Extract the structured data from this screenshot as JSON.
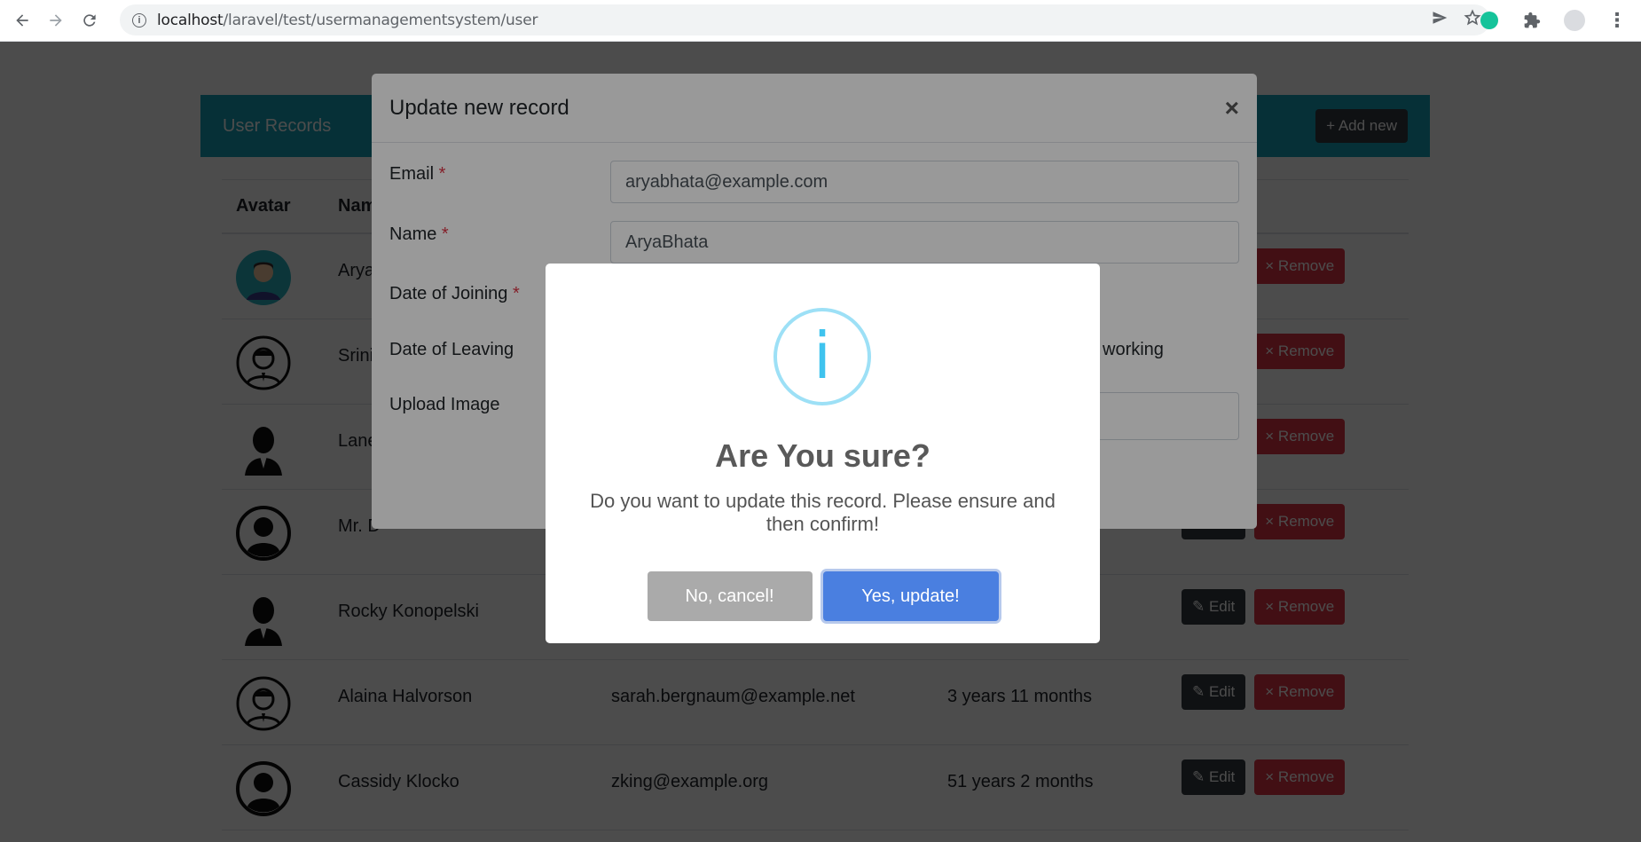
{
  "browser": {
    "url_host": "localhost",
    "url_path": "/laravel/test/usermanagementsystem/user"
  },
  "card": {
    "title": "User Records",
    "add_new_label": "+ Add new"
  },
  "table": {
    "headers": [
      "Avatar",
      "Name"
    ],
    "rows": [
      {
        "name": "Arya",
        "email": "",
        "duration": "",
        "avatar": "avatar-colored-icon"
      },
      {
        "name": "Srini",
        "email": "",
        "duration": "",
        "avatar": "man-outline-icon"
      },
      {
        "name": "Lane",
        "email": "",
        "duration": "",
        "avatar": "woman-silhouette-icon"
      },
      {
        "name": "Mr. D",
        "email": "",
        "duration": "",
        "avatar": "person-circle-icon"
      },
      {
        "name": "Rocky Konopelski",
        "email": "",
        "duration": "",
        "avatar": "woman-silhouette-icon"
      },
      {
        "name": "Alaina Halvorson",
        "email": "sarah.bergnaum@example.net",
        "duration": "3 years 11 months",
        "avatar": "man-outline-icon"
      },
      {
        "name": "Cassidy Klocko",
        "email": "zking@example.org",
        "duration": "51 years 2 months",
        "avatar": "person-circle-icon"
      }
    ],
    "edit_label": "✎ Edit",
    "remove_label": "× Remove"
  },
  "modal": {
    "title": "Update new record",
    "close": "×",
    "email_label": "Email",
    "email_value": "aryabhata@example.com",
    "name_label": "Name",
    "name_value": "AryaBhata",
    "doj_label": "Date of Joining",
    "dol_label": "Date of Leaving",
    "still_working": "working",
    "upload_label": "Upload Image",
    "required_mark": "*"
  },
  "alert": {
    "icon": "i",
    "title": "Are You sure?",
    "text": "Do you want to update this record. Please ensure and then confirm!",
    "cancel_label": "No, cancel!",
    "confirm_label": "Yes, update!"
  }
}
